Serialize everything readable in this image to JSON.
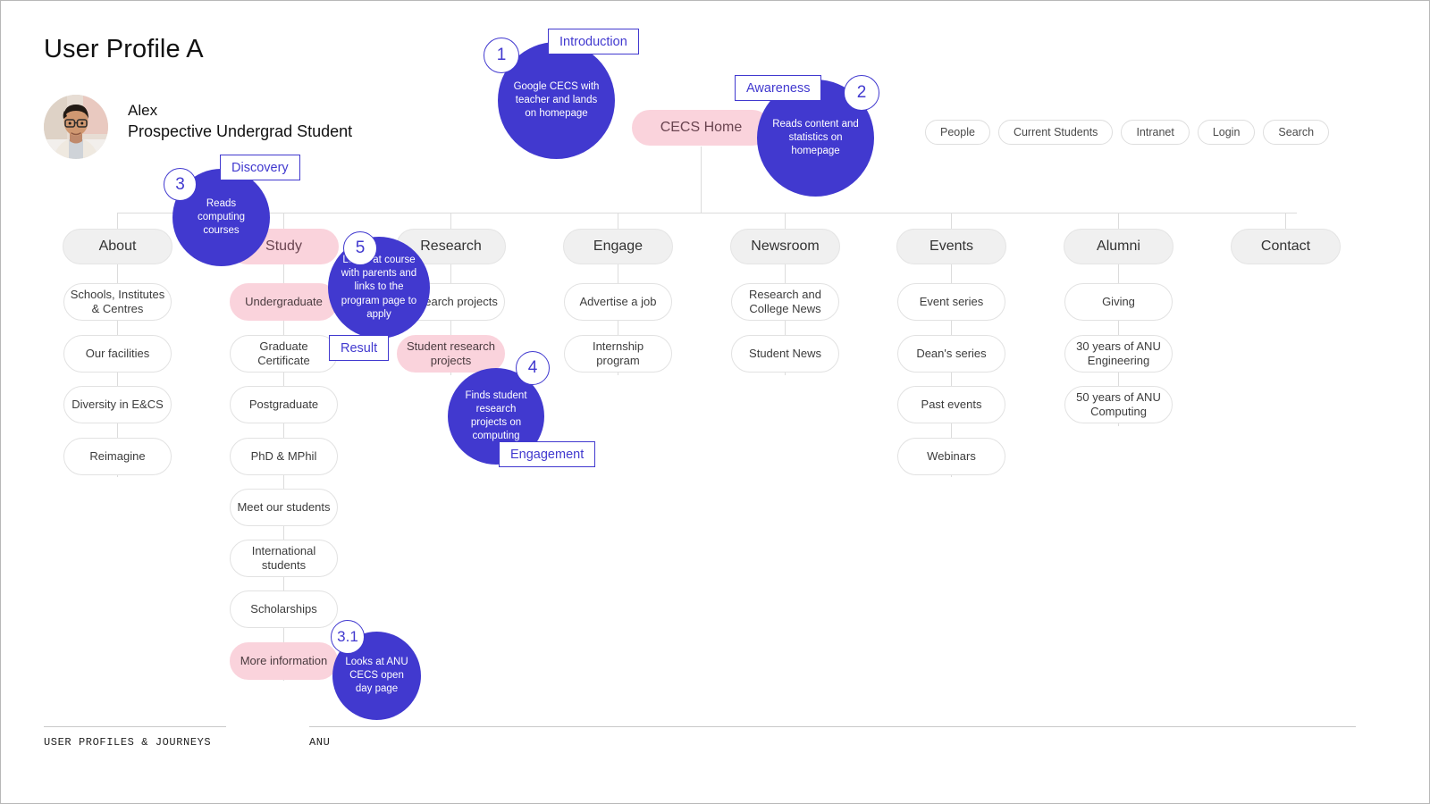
{
  "page": {
    "title": "User Profile A",
    "accent_blue": "#4139cf",
    "accent_pink": "#fad3dc",
    "node_grey": "#f0f0f0"
  },
  "persona": {
    "name": "Alex",
    "role": "Prospective Undergrad Student",
    "avatar_icon": "person-photo-avatar"
  },
  "utility_nav": [
    {
      "label": "People"
    },
    {
      "label": "Current Students"
    },
    {
      "label": "Intranet"
    },
    {
      "label": "Login"
    },
    {
      "label": "Search"
    }
  ],
  "root": {
    "label": "CECS Home"
  },
  "columns": [
    {
      "id": "about",
      "label": "About",
      "highlighted": false,
      "items": [
        {
          "label": "Schools, Institutes & Centres",
          "highlighted": false
        },
        {
          "label": "Our facilities",
          "highlighted": false
        },
        {
          "label": "Diversity in E&CS",
          "highlighted": false
        },
        {
          "label": "Reimagine",
          "highlighted": false
        }
      ]
    },
    {
      "id": "study",
      "label": "Study",
      "highlighted": true,
      "items": [
        {
          "label": "Undergraduate",
          "highlighted": true
        },
        {
          "label": "Graduate Certificate",
          "highlighted": false
        },
        {
          "label": "Postgraduate",
          "highlighted": false
        },
        {
          "label": "PhD & MPhil",
          "highlighted": false
        },
        {
          "label": "Meet our students",
          "highlighted": false
        },
        {
          "label": "International students",
          "highlighted": false
        },
        {
          "label": "Scholarships",
          "highlighted": false
        },
        {
          "label": "More information",
          "highlighted": true
        }
      ]
    },
    {
      "id": "research",
      "label": "Research",
      "highlighted": false,
      "items": [
        {
          "label": "Research projects",
          "highlighted": false
        },
        {
          "label": "Student research projects",
          "highlighted": true
        }
      ]
    },
    {
      "id": "engage",
      "label": "Engage",
      "highlighted": false,
      "items": [
        {
          "label": "Advertise a job",
          "highlighted": false
        },
        {
          "label": "Internship program",
          "highlighted": false
        }
      ]
    },
    {
      "id": "newsroom",
      "label": "Newsroom",
      "highlighted": false,
      "items": [
        {
          "label": "Research and College News",
          "highlighted": false
        },
        {
          "label": "Student News",
          "highlighted": false
        }
      ]
    },
    {
      "id": "events",
      "label": "Events",
      "highlighted": false,
      "items": [
        {
          "label": "Event series",
          "highlighted": false
        },
        {
          "label": "Dean's series",
          "highlighted": false
        },
        {
          "label": "Past events",
          "highlighted": false
        },
        {
          "label": "Webinars",
          "highlighted": false
        }
      ]
    },
    {
      "id": "alumni",
      "label": "Alumni",
      "highlighted": false,
      "items": [
        {
          "label": "Giving",
          "highlighted": false
        },
        {
          "label": "30 years of ANU Engineering",
          "highlighted": false
        },
        {
          "label": "50 years of ANU Computing",
          "highlighted": false
        }
      ]
    },
    {
      "id": "contact",
      "label": "Contact",
      "highlighted": false,
      "items": []
    }
  ],
  "journey_steps": [
    {
      "number": "1",
      "text": "Google CECS with teacher and lands on homepage",
      "stage": "Introduction"
    },
    {
      "number": "2",
      "text": "Reads content and statistics on homepage",
      "stage": "Awareness"
    },
    {
      "number": "3",
      "text": "Reads computing courses",
      "stage": "Discovery"
    },
    {
      "number": "3.1",
      "text": "Looks at ANU CECS open day page",
      "stage": ""
    },
    {
      "number": "4",
      "text": "Finds student research projects on computing",
      "stage": "Engagement"
    },
    {
      "number": "5",
      "text": "Looks at course with parents and links to the program page to apply",
      "stage": "Result"
    }
  ],
  "footer": {
    "left": "USER PROFILES & JOURNEYS",
    "right": "ANU"
  }
}
